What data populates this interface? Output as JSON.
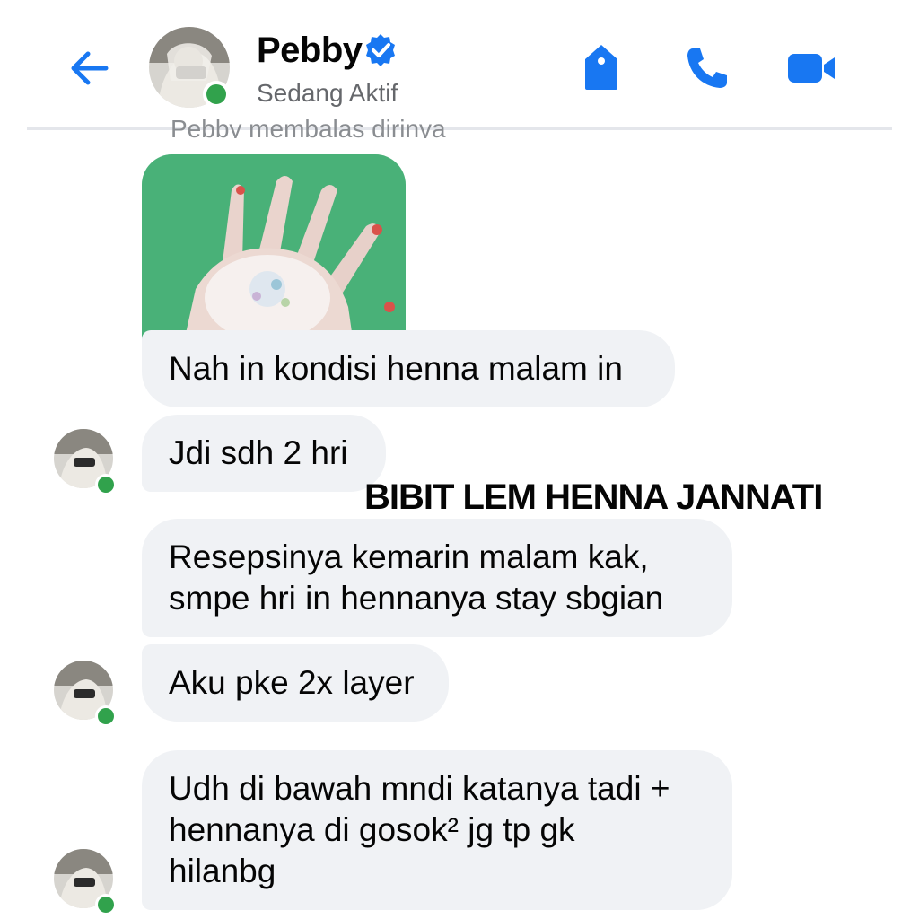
{
  "header": {
    "contact_name": "Pebby",
    "status": "Sedang Aktif",
    "accent_color": "#1877f2",
    "online_color": "#31a24c",
    "icons": [
      "back-arrow-icon",
      "verified-badge-icon",
      "tag-icon",
      "phone-icon",
      "video-camera-icon"
    ]
  },
  "conversation": {
    "reply_note": "Pebby membalas dirinya",
    "messages": [
      {
        "type": "image",
        "description_icon": "henna-hand-photo"
      },
      {
        "type": "text",
        "text": "Nah in kondisi henna malam in"
      },
      {
        "type": "text",
        "text": "Jdi sdh 2 hri"
      },
      {
        "type": "text",
        "text": "Resepsinya kemarin malam kak,\nsmpe hri in hennanya stay sbgian"
      },
      {
        "type": "text",
        "text": "Aku pke 2x layer"
      },
      {
        "type": "text",
        "text": "Udh di bawah mndi katanya tadi +\nhennanya di gosok² jg tp gk\nhilanbg"
      }
    ]
  },
  "overlay": {
    "watermark": "BIBIT LEM HENNA JANNATI"
  }
}
